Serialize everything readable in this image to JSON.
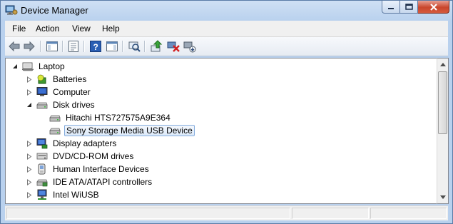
{
  "window": {
    "title": "Device Manager",
    "icon": "device-manager-icon"
  },
  "caption_buttons": [
    "minimize-icon",
    "maximize-icon",
    "close-icon"
  ],
  "menu": {
    "items": [
      "File",
      "Action",
      "View",
      "Help"
    ]
  },
  "toolbar": {
    "buttons": [
      {
        "name": "back-icon"
      },
      {
        "name": "forward-icon"
      },
      {
        "name": "show-hide-console-tree-icon"
      },
      {
        "name": "properties-icon"
      },
      {
        "name": "help-icon"
      },
      {
        "name": "show-hide-action-pane-icon"
      },
      {
        "name": "scan-hardware-changes-icon"
      },
      {
        "name": "update-driver-icon"
      },
      {
        "name": "uninstall-device-icon"
      },
      {
        "name": "disable-device-icon"
      }
    ]
  },
  "tree": {
    "root": {
      "label": "Laptop",
      "expanded": true,
      "icon": "computer-icon"
    },
    "items": [
      {
        "label": "Batteries",
        "icon": "battery-icon",
        "expanded": false,
        "level": 1
      },
      {
        "label": "Computer",
        "icon": "monitor-icon",
        "expanded": false,
        "level": 1
      },
      {
        "label": "Disk drives",
        "icon": "disk-drive-icon",
        "expanded": true,
        "level": 1
      },
      {
        "label": "Hitachi HTS727575A9E364",
        "icon": "disk-drive-icon",
        "level": 2
      },
      {
        "label": "Sony Storage Media USB Device",
        "icon": "disk-drive-icon",
        "level": 2,
        "selected": true
      },
      {
        "label": "Display adapters",
        "icon": "display-adapter-icon",
        "expanded": false,
        "level": 1
      },
      {
        "label": "DVD/CD-ROM drives",
        "icon": "optical-drive-icon",
        "expanded": false,
        "level": 1
      },
      {
        "label": "Human Interface Devices",
        "icon": "hid-icon",
        "expanded": false,
        "level": 1
      },
      {
        "label": "IDE ATA/ATAPI controllers",
        "icon": "ide-controller-icon",
        "expanded": false,
        "level": 1
      },
      {
        "label": "Intel WiUSB",
        "icon": "network-icon",
        "expanded": false,
        "level": 1
      }
    ]
  },
  "colors": {
    "title_bg": "#b9d1ee",
    "close_button": "#c9462c",
    "selection_border": "#84acdd",
    "selection_fill": "#dceaf9"
  }
}
